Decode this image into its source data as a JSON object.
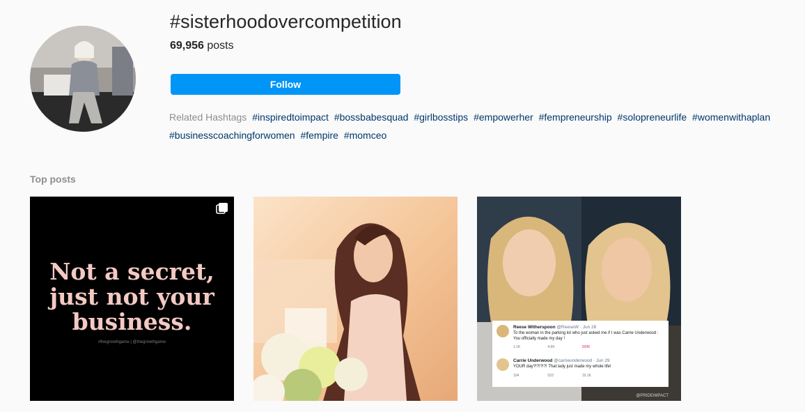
{
  "header": {
    "hashtag_title": "#sisterhoodovercompetition",
    "post_count": "69,956",
    "post_count_suffix": " posts",
    "follow_label": "Follow"
  },
  "related": {
    "label": "Related Hashtags",
    "tags": [
      "#inspiredtoimpact",
      "#bossbabesquad",
      "#girlbosstips",
      "#empowerher",
      "#fempreneurship",
      "#solopreneurlife",
      "#womenwithaplan",
      "#businesscoachingforwomen",
      "#fempire",
      "#momceo"
    ]
  },
  "top_posts": {
    "title": "Top posts",
    "post1": {
      "quote_lines": [
        "Not a secret,",
        "just not your",
        "business."
      ],
      "credit": "#thegrowthgame | @thegrowthgame",
      "icon": "multiple-posts-icon"
    },
    "post3": {
      "tweet1": {
        "name": "Reese Witherspoon",
        "handle": "@ReeseW · Jun 28",
        "text": "To the woman in the parking lot who just asked me if I was Carrie Underwood : You officially made my day !",
        "replies": "1.1K",
        "retweets": "4.6K",
        "likes": "200K"
      },
      "tweet2": {
        "name": "Carrie Underwood",
        "handle": "@carrieunderwood · Jun 29",
        "text": "YOUR day?!?!?!?! That lady just made my whole life!",
        "replies": "104",
        "retweets": "533",
        "likes": "19.1K"
      },
      "watermark": "@PRIDEIMPACT"
    }
  },
  "colors": {
    "background": "#fafafa",
    "follow_button": "#0095f6",
    "hashtag_link": "#00376b",
    "muted_text": "#8e8e8e"
  }
}
